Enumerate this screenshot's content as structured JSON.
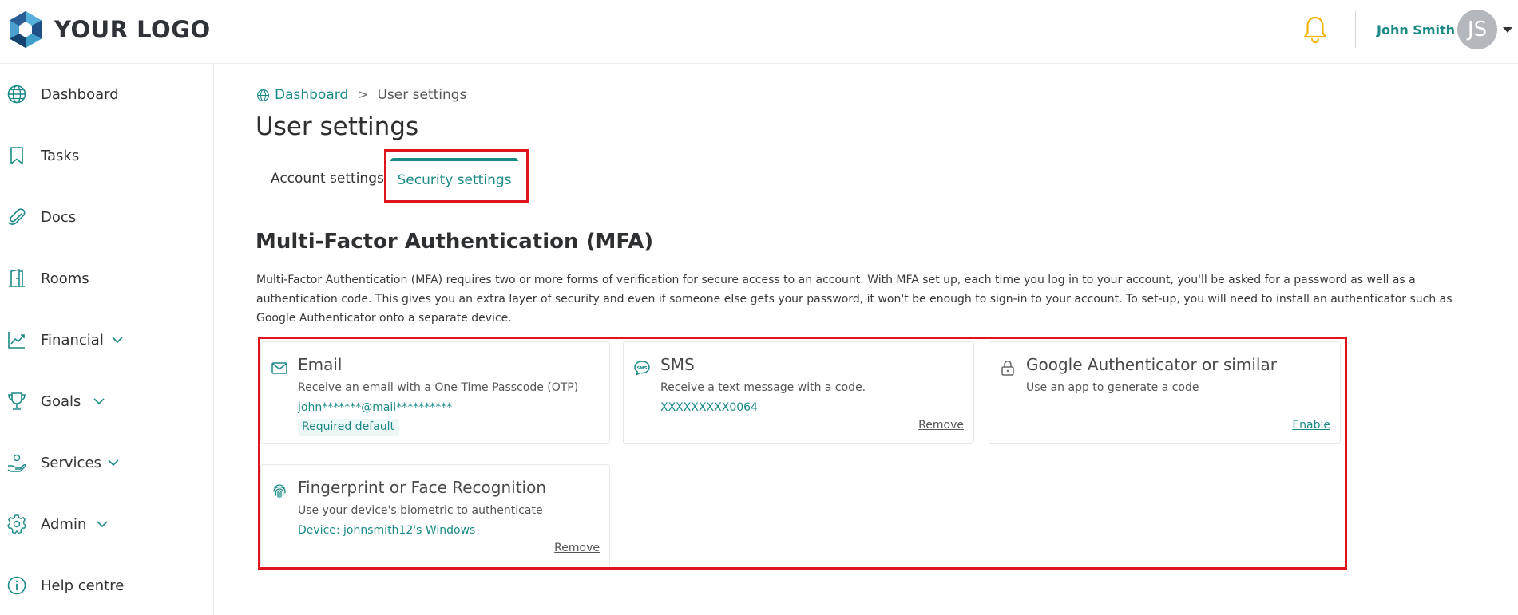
{
  "header": {
    "logo_text": "YOUR LOGO",
    "user_name": "John Smith",
    "avatar_initials": "JS",
    "icons": [
      "logo-icon",
      "bell-icon",
      "caret-down-icon"
    ],
    "colors": {
      "accent": "#1b8a87",
      "bell": "#f5b400",
      "highlight": "#e0141d"
    }
  },
  "sidebar": {
    "items": [
      {
        "label": "Dashboard",
        "icon": "globe-icon",
        "has_submenu": false
      },
      {
        "label": "Tasks",
        "icon": "bookmark-icon",
        "has_submenu": false
      },
      {
        "label": "Docs",
        "icon": "paperclip-icon",
        "has_submenu": false
      },
      {
        "label": "Rooms",
        "icon": "door-icon",
        "has_submenu": false
      },
      {
        "label": "Financial",
        "icon": "chart-line-icon",
        "has_submenu": true
      },
      {
        "label": "Goals",
        "icon": "trophy-icon",
        "has_submenu": true
      },
      {
        "label": "Services",
        "icon": "hand-service-icon",
        "has_submenu": true
      },
      {
        "label": "Admin",
        "icon": "gear-icon",
        "has_submenu": true
      },
      {
        "label": "Help centre",
        "icon": "info-icon",
        "has_submenu": false
      }
    ]
  },
  "breadcrumb": {
    "home": "Dashboard",
    "separator": ">",
    "current": "User settings"
  },
  "page": {
    "title": "User settings",
    "tabs": [
      {
        "label": "Account settings",
        "active": false
      },
      {
        "label": "Security settings",
        "active": true
      }
    ]
  },
  "mfa": {
    "title": "Multi-Factor Authentication (MFA)",
    "description": "Multi-Factor Authentication (MFA) requires two or more forms of verification for secure access to an account. With MFA set up, each time you log in to your account, you'll be asked for a password as well as a authentication code. This gives you an extra layer of security and even if someone else gets your password, it won't be enough to sign-in to your account. To set-up, you will need to install an authenticator such as Google Authenticator onto a separate device.",
    "methods": [
      {
        "title": "Email",
        "icon": "mail-icon",
        "description": "Receive an email with a One Time Passcode (OTP)",
        "value": "john*******@mail**********",
        "badge": "Required default",
        "action": ""
      },
      {
        "title": "SMS",
        "icon": "sms-icon",
        "description": "Receive a text message with a code.",
        "value": "XXXXXXXXX0064",
        "badge": "",
        "action": "Remove"
      },
      {
        "title": "Google Authenticator or similar",
        "icon": "lock-icon",
        "description": "Use an app to generate a code",
        "value": "",
        "badge": "",
        "action": "Enable"
      },
      {
        "title": "Fingerprint or Face Recognition",
        "icon": "fingerprint-icon",
        "description": "Use your device's biometric to authenticate",
        "value": "Device: johnsmith12's Windows",
        "badge": "",
        "action": "Remove"
      }
    ]
  }
}
